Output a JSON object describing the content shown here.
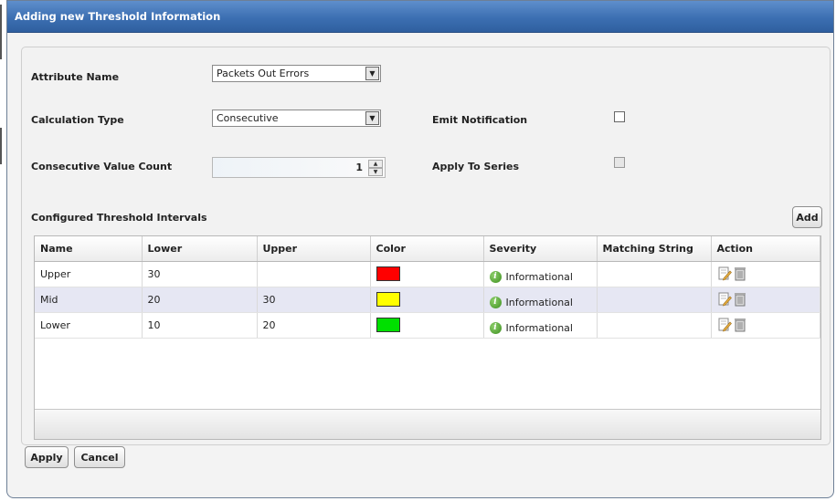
{
  "dialog": {
    "title": "Adding new Threshold Information"
  },
  "form": {
    "attribute_name_label": "Attribute Name",
    "attribute_name_value": "Packets Out Errors",
    "calculation_type_label": "Calculation Type",
    "calculation_type_value": "Consecutive",
    "consecutive_count_label": "Consecutive Value Count",
    "consecutive_count_value": "1",
    "emit_notification_label": "Emit Notification",
    "emit_notification_checked": false,
    "apply_to_series_label": "Apply To Series",
    "apply_to_series_checked": false
  },
  "intervals": {
    "heading": "Configured Threshold Intervals",
    "add_label": "Add",
    "columns": [
      "Name",
      "Lower",
      "Upper",
      "Color",
      "Severity",
      "Matching String",
      "Action"
    ],
    "rows": [
      {
        "name": "Upper",
        "lower": "30",
        "upper": "",
        "color": "#ff0000",
        "severity": "Informational",
        "matching": ""
      },
      {
        "name": "Mid",
        "lower": "20",
        "upper": "30",
        "color": "#ffff00",
        "severity": "Informational",
        "matching": ""
      },
      {
        "name": "Lower",
        "lower": "10",
        "upper": "20",
        "color": "#00e000",
        "severity": "Informational",
        "matching": ""
      }
    ]
  },
  "footer": {
    "apply_label": "Apply",
    "cancel_label": "Cancel"
  },
  "icons": {
    "severity": "info-icon",
    "edit": "edit-icon",
    "delete": "delete-icon"
  }
}
